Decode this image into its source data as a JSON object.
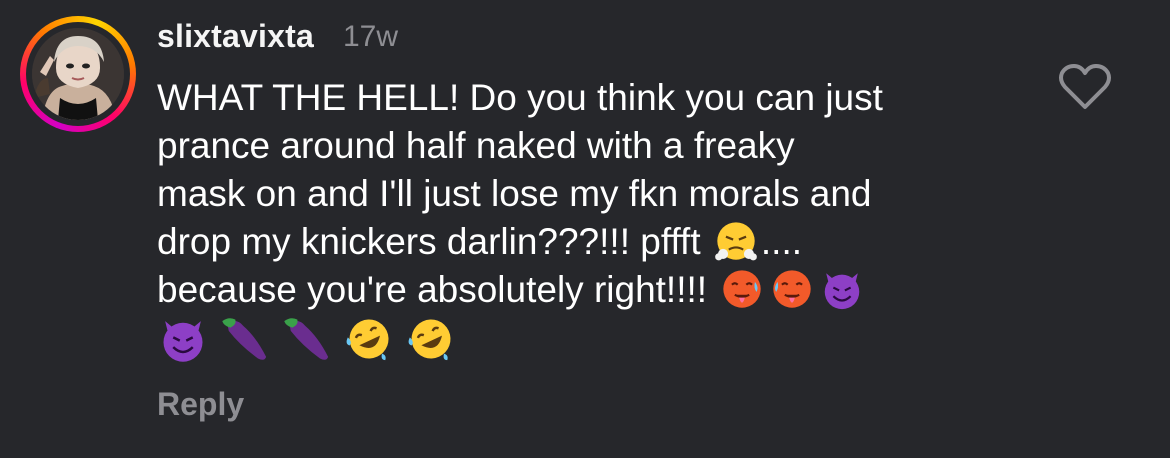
{
  "comment": {
    "username": "slixtavixta",
    "timestamp": "17w",
    "avatar": {
      "icon": "user-avatar-photo",
      "ring_colors": [
        "#d300c5",
        "#ff0069",
        "#ff7a00",
        "#ffd600"
      ]
    },
    "text_lines": [
      "WHAT THE HELL! Do you think you can just",
      "prance around half naked with a freaky",
      "mask on and I'll just lose my fkn morals and",
      "drop my knickers darlin???!!! pffft",
      "....",
      "because you're absolutely right!!!!"
    ],
    "emojis": {
      "line4": [
        "face-with-steam-from-nose"
      ],
      "line5": [
        "hot-face",
        "hot-face",
        "smiling-face-with-horns"
      ],
      "line6": [
        "smiling-face-with-horns",
        "eggplant",
        "eggplant",
        "rolling-on-the-floor-laughing",
        "rolling-on-the-floor-laughing"
      ]
    },
    "reply_label": "Reply",
    "like_icon": "heart-outline-icon"
  },
  "colors": {
    "background": "#26272b",
    "text": "#ffffff",
    "secondary": "#8e8e93"
  }
}
